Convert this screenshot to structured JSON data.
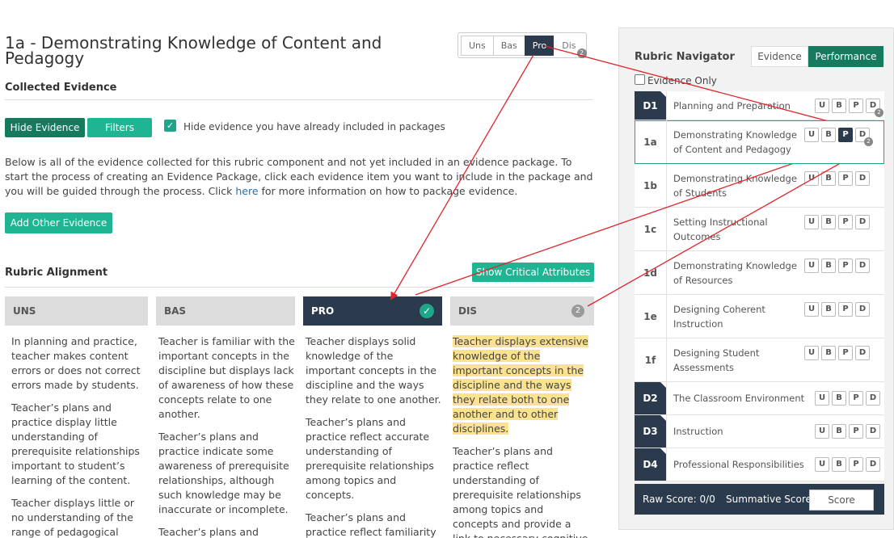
{
  "title": "1a  -  Demonstrating Knowledge of Content and Pedagogy",
  "level_tabs": [
    {
      "label": "Uns",
      "active": false
    },
    {
      "label": "Bas",
      "active": false
    },
    {
      "label": "Pro",
      "active": true
    },
    {
      "label": "Dis",
      "active": false,
      "badge": "2"
    }
  ],
  "collected_evidence": {
    "heading": "Collected Evidence",
    "hide_evidence_label": "Hide Evidence",
    "filters_label": "Filters",
    "hide_included_label": "Hide evidence you have already included in packages",
    "hide_included_checked": true,
    "description_1": "Below is all of the evidence collected for this rubric component and not yet included in an evidence package. To start the process of creating an Evidence Package, click each evidence item you want to include in the package and you will be guided through the process. Click ",
    "link_text": "here",
    "description_2": " for more information on how to package evidence.",
    "add_other_label": "Add Other Evidence"
  },
  "rubric_alignment": {
    "heading": "Rubric Alignment",
    "show_critical_label": "Show Critical Attributes",
    "columns": [
      {
        "header": "UNS",
        "paragraphs": [
          "In planning and practice, teacher makes content errors or does not correct errors made by students.",
          "Teacher’s plans and practice display little understanding of prerequisite relationships important to student’s learning of the content.",
          "Teacher displays little or no understanding of the range of pedagogical approaches"
        ]
      },
      {
        "header": "BAS",
        "paragraphs": [
          "Teacher is familiar with the important concepts in the discipline but displays lack of awareness of how these concepts relate to one another.",
          "Teacher’s plans and practice indicate some awareness of prerequisite relationships, although such knowledge may be inaccurate or incomplete.",
          "Teacher’s plans and"
        ]
      },
      {
        "header": "PRO",
        "paragraphs": [
          "Teacher displays solid knowledge of the important concepts in the discipline and the ways they relate to one another.",
          "Teacher’s plans and practice reflect accurate understanding of prerequisite relationships among topics and concepts.",
          "Teacher’s plans and practice reflect familiarity"
        ]
      },
      {
        "header": "DIS",
        "badge": "2",
        "paragraphs": [
          "Teacher displays extensive knowledge of the important concepts in the discipline and the ways they relate both to one another and to other disciplines.",
          "Teacher’s plans and practice reflect understanding of prerequisite relationships among topics and concepts and provide a link to necessary cognitive"
        ]
      }
    ]
  },
  "navigator": {
    "title": "Rubric Navigator",
    "toggle": [
      {
        "label": "Evidence",
        "active": false
      },
      {
        "label": "Performance",
        "active": true
      }
    ],
    "evidence_only_label": "Evidence Only",
    "evidence_only_checked": false,
    "rows": [
      {
        "code": "D1",
        "name": "Planning and Preparation",
        "domain": true,
        "selected_level": "",
        "badge": "2"
      },
      {
        "code": "1a",
        "name": "Demonstrating Knowledge of Content and Pedagogy",
        "domain": false,
        "selected_level": "P",
        "badge": "2",
        "current": true
      },
      {
        "code": "1b",
        "name": "Demonstrating Knowledge of Students",
        "domain": false,
        "selected_level": ""
      },
      {
        "code": "1c",
        "name": "Setting Instructional Outcomes",
        "domain": false,
        "selected_level": ""
      },
      {
        "code": "1d",
        "name": "Demonstrating Knowledge of Resources",
        "domain": false,
        "selected_level": ""
      },
      {
        "code": "1e",
        "name": "Designing Coherent Instruction",
        "domain": false,
        "selected_level": ""
      },
      {
        "code": "1f",
        "name": "Designing Student Assessments",
        "domain": false,
        "selected_level": ""
      },
      {
        "code": "D2",
        "name": "The Classroom Environment",
        "domain": true,
        "selected_level": ""
      },
      {
        "code": "D3",
        "name": "Instruction",
        "domain": true,
        "selected_level": ""
      },
      {
        "code": "D4",
        "name": "Professional Responsibilities",
        "domain": true,
        "selected_level": ""
      }
    ],
    "level_buttons": [
      "U",
      "B",
      "P",
      "D"
    ],
    "raw_score_label": "Raw Score: 0/0",
    "summative_label": "Summative Score",
    "score_button": "Score"
  },
  "colors": {
    "dark": "#2b3a4c",
    "green": "#1fa58a",
    "highlight": "#fbe38e",
    "arrow": "#e0252b"
  }
}
